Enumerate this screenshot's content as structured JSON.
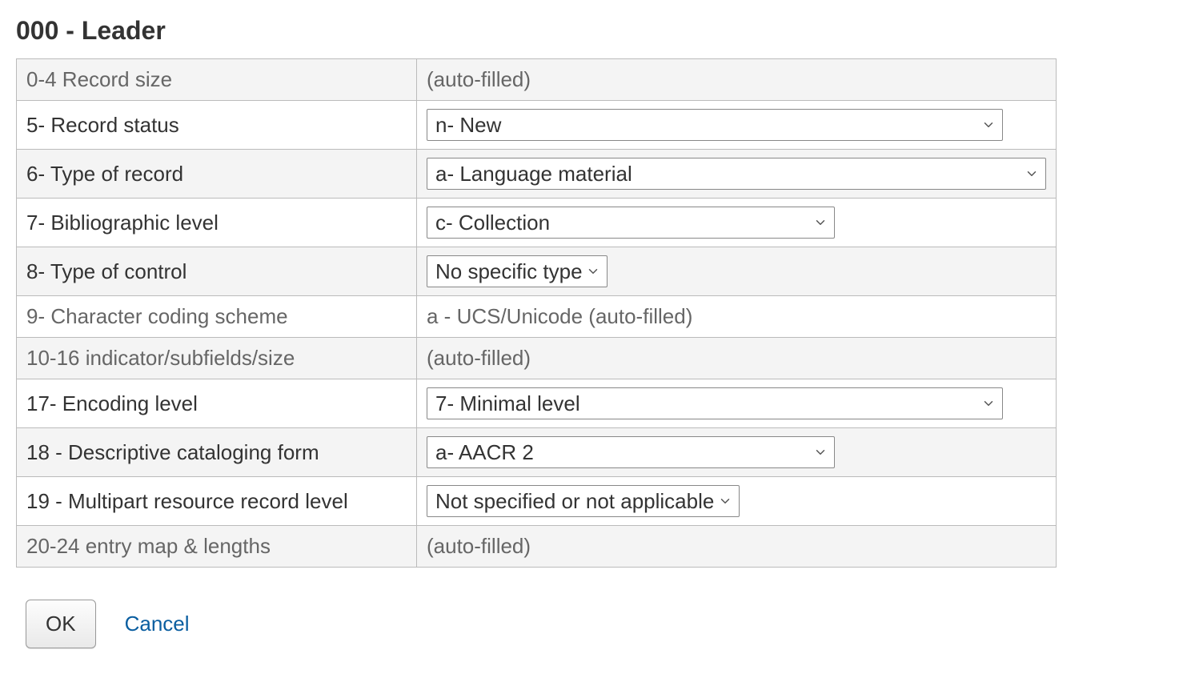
{
  "title": "000 - Leader",
  "rows": {
    "r0": {
      "label": "0-4 Record size",
      "value": "(auto-filled)"
    },
    "r1": {
      "label": "5- Record status",
      "value": "n- New"
    },
    "r2": {
      "label": "6- Type of record",
      "value": "a- Language material"
    },
    "r3": {
      "label": "7- Bibliographic level",
      "value": "c- Collection"
    },
    "r4": {
      "label": "8- Type of control",
      "value": "No specific type"
    },
    "r5": {
      "label": "9- Character coding scheme",
      "value": "a - UCS/Unicode (auto-filled)"
    },
    "r6": {
      "label": "10-16 indicator/subfields/size",
      "value": "(auto-filled)"
    },
    "r7": {
      "label": "17- Encoding level",
      "value": "7- Minimal level"
    },
    "r8": {
      "label": "18 - Descriptive cataloging form",
      "value": "a- AACR 2"
    },
    "r9": {
      "label": "19 - Multipart resource record level",
      "value": "Not specified or not applicable"
    },
    "r10": {
      "label": "20-24 entry map & lengths",
      "value": "(auto-filled)"
    }
  },
  "buttons": {
    "ok": "OK",
    "cancel": "Cancel"
  }
}
